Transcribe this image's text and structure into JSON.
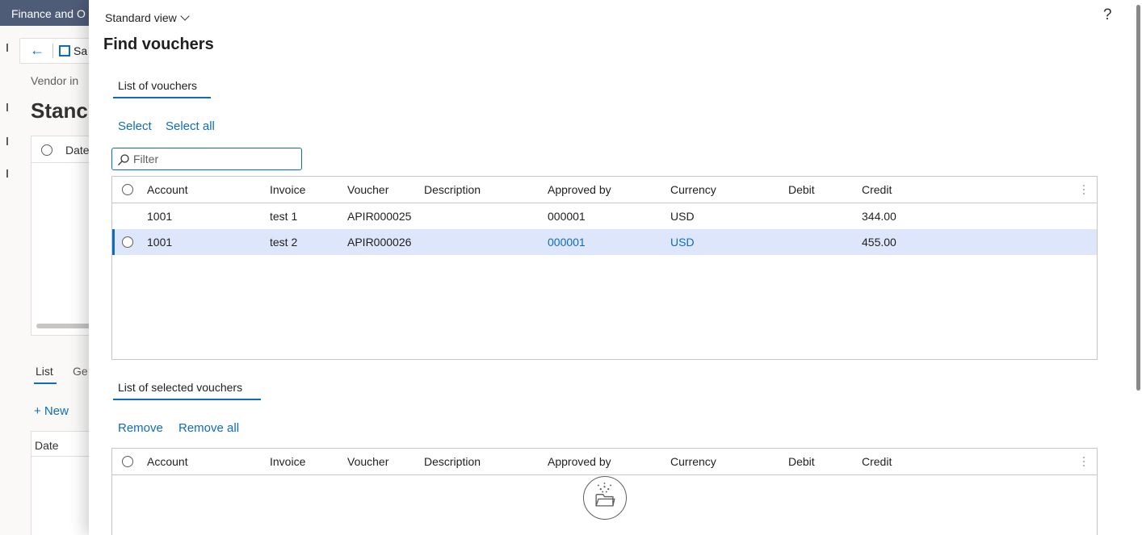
{
  "background": {
    "app_title": "Finance and O",
    "toolbar_save_label": "Sa",
    "breadcrumb": "Vendor in",
    "page_title": "Stanc",
    "grid_header_date": "Date",
    "tabs": {
      "list": "List",
      "general": "Ge"
    },
    "new_button": "+ New",
    "grid2_header_date": "Date"
  },
  "dialog": {
    "view_selector": "Standard view",
    "help_label": "?",
    "title": "Find vouchers",
    "list_section": {
      "tab_label": "List of vouchers",
      "actions": {
        "select": "Select",
        "select_all": "Select all"
      },
      "filter_placeholder": "Filter",
      "columns": [
        "Account",
        "Invoice",
        "Voucher",
        "Description",
        "Approved by",
        "Currency",
        "Debit",
        "Credit"
      ],
      "rows": [
        {
          "account": "1001",
          "invoice": "test 1",
          "voucher": "APIR000025",
          "description": "",
          "approved_by": "000001",
          "currency": "USD",
          "debit": "",
          "credit": "344.00",
          "selected": false
        },
        {
          "account": "1001",
          "invoice": "test 2",
          "voucher": "APIR000026",
          "description": "",
          "approved_by": "000001",
          "currency": "USD",
          "debit": "",
          "credit": "455.00",
          "selected": true
        }
      ]
    },
    "selected_section": {
      "tab_label": "List of selected vouchers",
      "actions": {
        "remove": "Remove",
        "remove_all": "Remove all"
      },
      "columns": [
        "Account",
        "Invoice",
        "Voucher",
        "Description",
        "Approved by",
        "Currency",
        "Debit",
        "Credit"
      ],
      "empty_icon": "empty-folder-icon"
    }
  },
  "colors": {
    "accent": "#0f6cbd",
    "header_bar": "#4e5c78",
    "selected_row": "#dde6fb"
  }
}
